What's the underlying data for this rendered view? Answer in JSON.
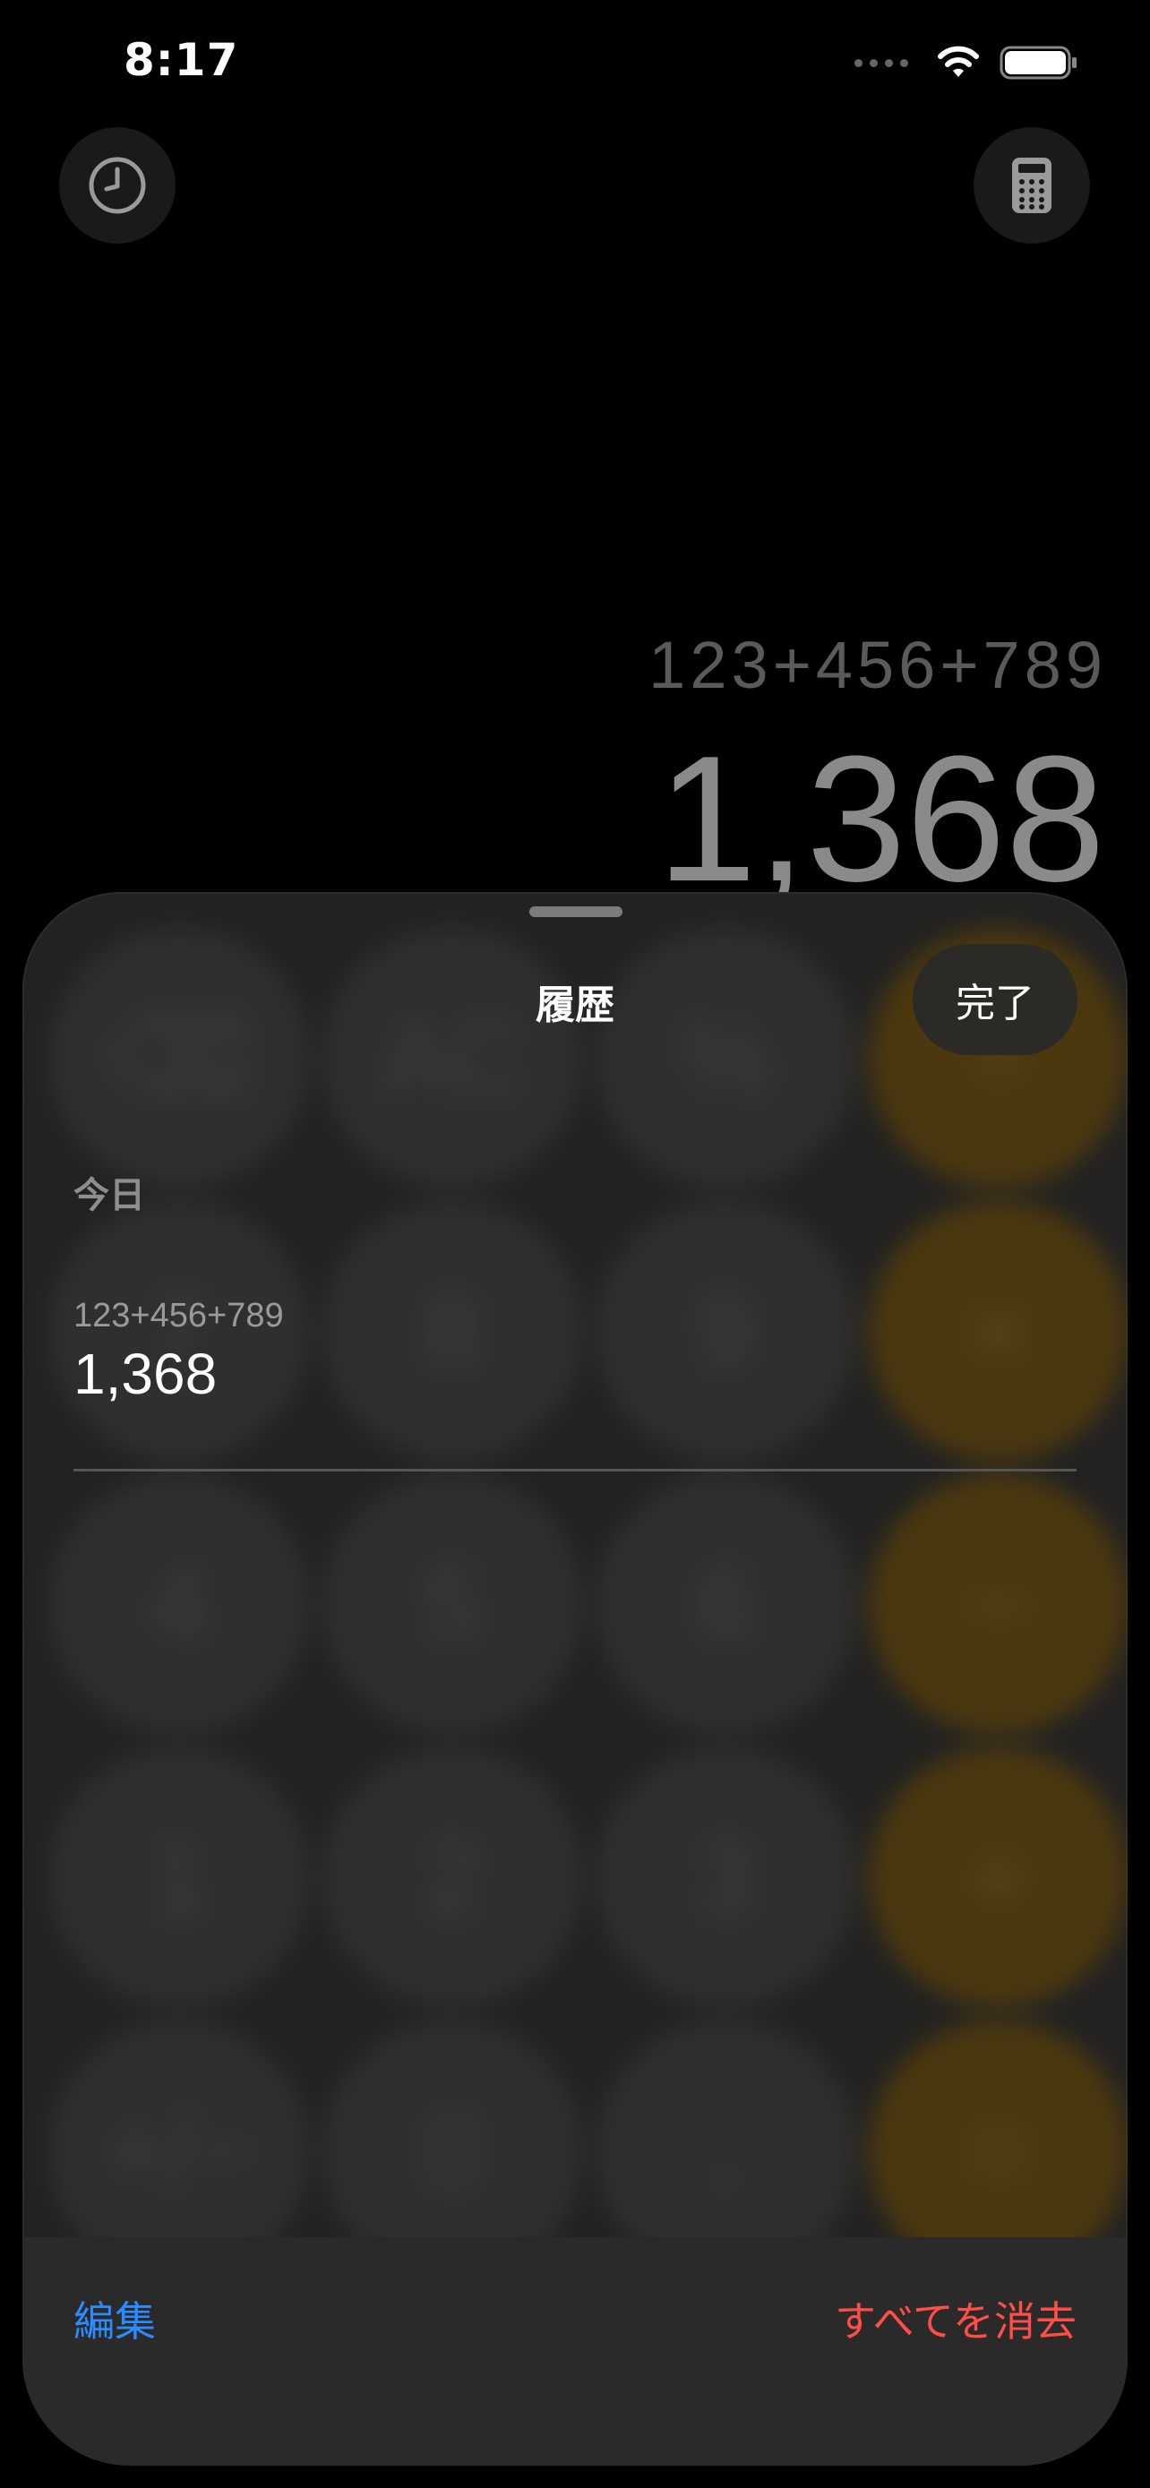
{
  "status_bar": {
    "time": "8:17"
  },
  "display": {
    "expression": "123+456+789",
    "result": "1,368"
  },
  "keypad_background": {
    "row1": [
      "⌫",
      "AC",
      "%",
      "÷"
    ],
    "row2": [
      "7",
      "8",
      "9",
      "×"
    ],
    "row3": [
      "4",
      "5",
      "6",
      "−"
    ],
    "row4": [
      "1",
      "2",
      "3",
      "+"
    ],
    "row5": [
      "+/−",
      "0",
      ".",
      "="
    ]
  },
  "history_sheet": {
    "title": "履歴",
    "done_label": "完了",
    "section": "今日",
    "items": [
      {
        "expression": "123+456+789",
        "result": "1,368"
      }
    ],
    "edit_label": "編集",
    "clear_all_label": "すべてを消去"
  },
  "colors": {
    "accent_blue": "#2a8cff",
    "destructive_red": "#ff4d48",
    "operator_orange": "#ff9f0a"
  },
  "icons": {
    "history": "clock-icon",
    "mode": "calculator-icon"
  }
}
